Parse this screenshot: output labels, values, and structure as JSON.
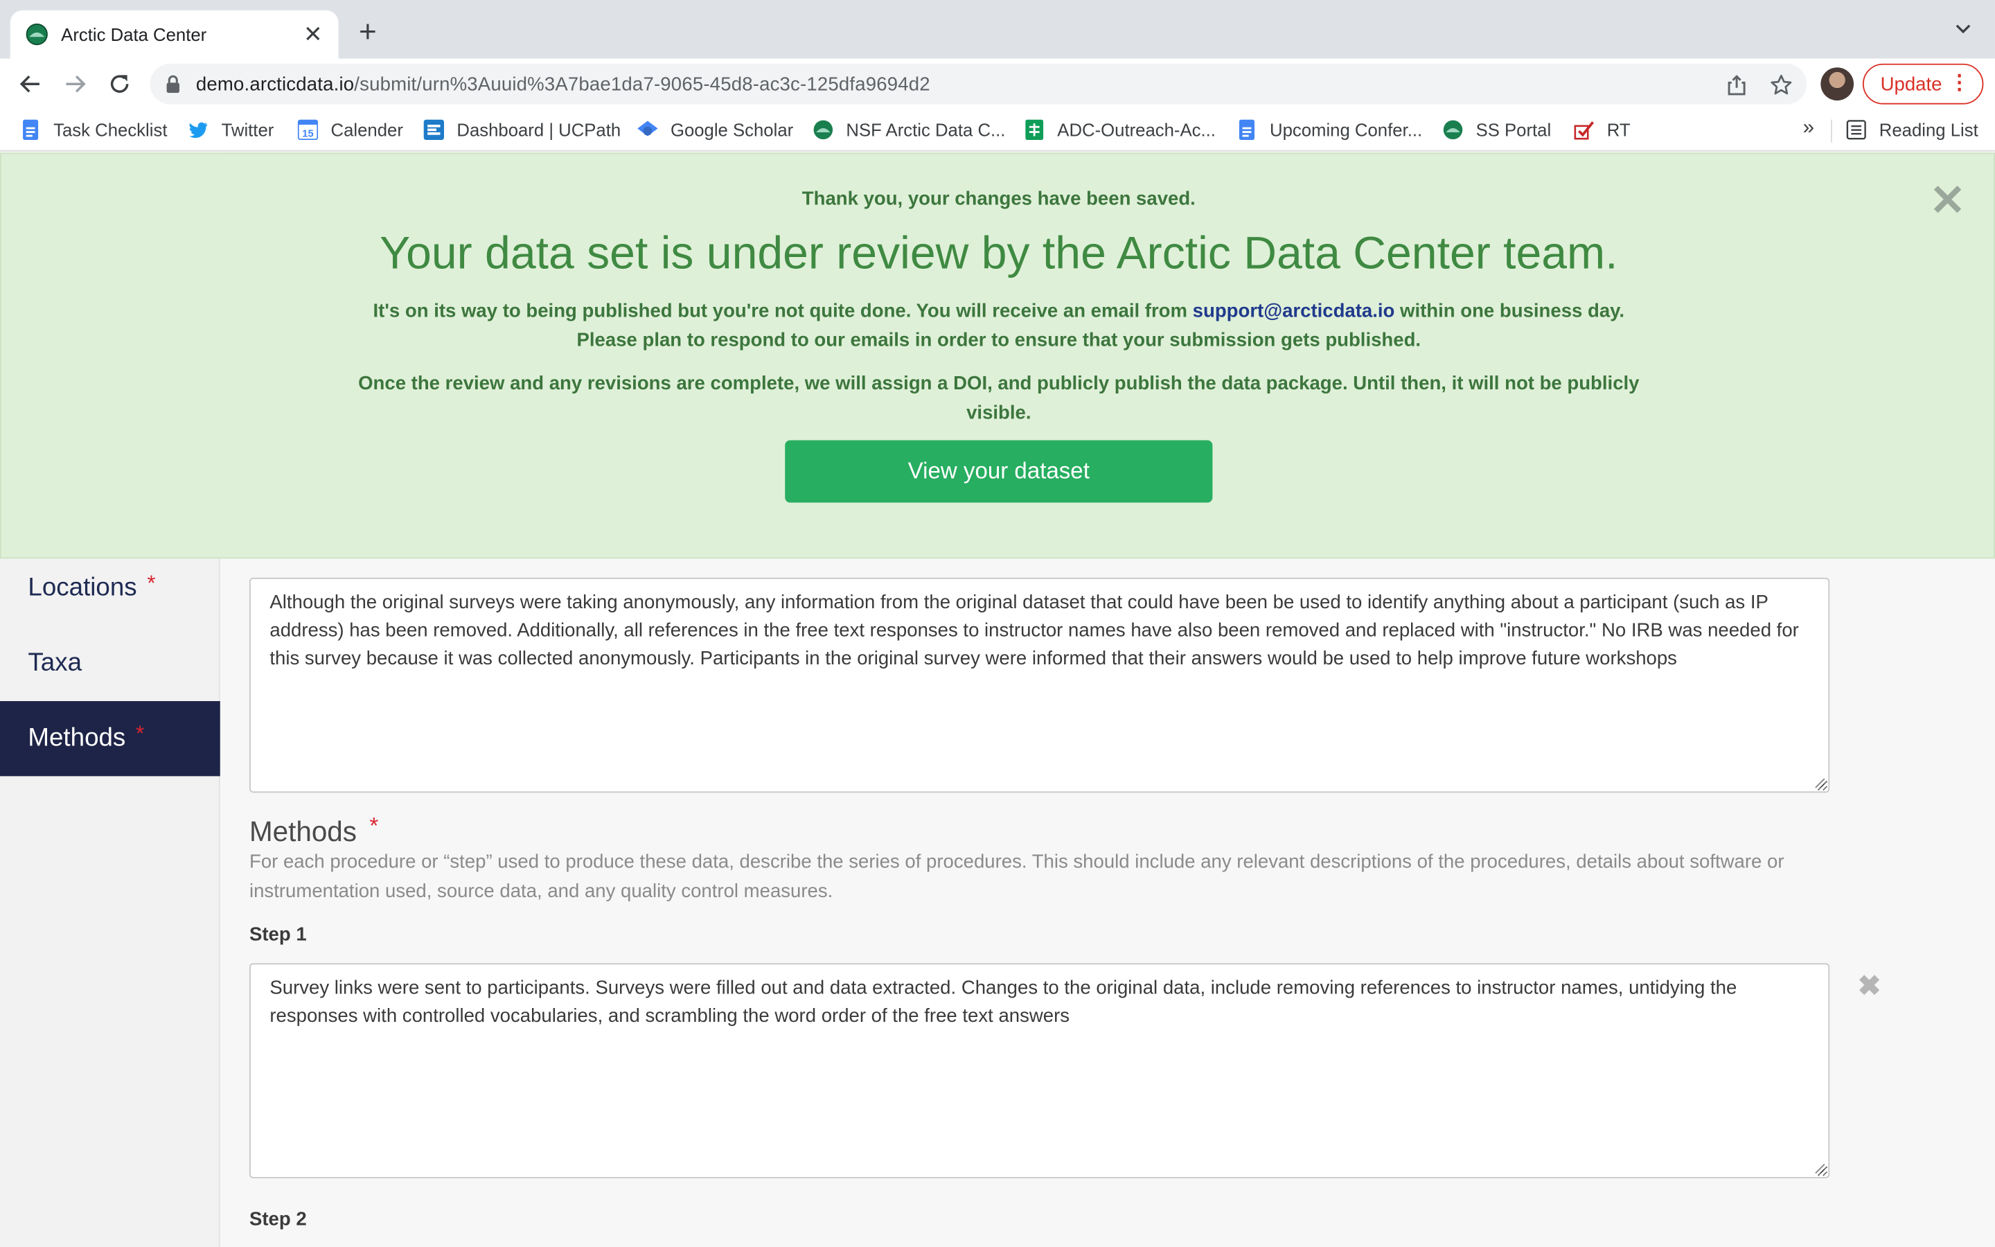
{
  "browser": {
    "tab_title": "Arctic Data Center",
    "url_host": "demo.arcticdata.io",
    "url_path": "/submit/urn%3Auuid%3A7bae1da7-9065-45d8-ac3c-125dfa9694d2",
    "update_label": "Update",
    "reading_list_label": "Reading List",
    "bookmarks": [
      {
        "label": "Task Checklist",
        "icon": "google-docs-icon"
      },
      {
        "label": "Twitter",
        "icon": "twitter-icon"
      },
      {
        "label": "Calender",
        "icon": "calendar-icon"
      },
      {
        "label": "Dashboard | UCPath",
        "icon": "ucpath-icon"
      },
      {
        "label": "Google Scholar",
        "icon": "scholar-icon"
      },
      {
        "label": "NSF Arctic Data C...",
        "icon": "arctic-data-icon"
      },
      {
        "label": "ADC-Outreach-Ac...",
        "icon": "google-sheets-icon"
      },
      {
        "label": "Upcoming Confer...",
        "icon": "google-docs-icon"
      },
      {
        "label": "SS Portal",
        "icon": "arctic-data-icon"
      },
      {
        "label": "RT",
        "icon": "rt-icon"
      }
    ]
  },
  "banner": {
    "saved_message": "Thank you, your changes have been saved.",
    "headline": "Your data set is under review by the Arctic Data Center team.",
    "line1_pre": "It's on its way to being published but you're not quite done. You will receive an email from ",
    "line1_email": "support@arcticdata.io",
    "line1_post": " within one business day.",
    "line2": "Please plan to respond to our emails in order to ensure that your submission gets published.",
    "line3": "Once the review and any revisions are complete, we will assign a DOI, and publicly publish the data package. Until then, it will not be publicly visible.",
    "view_button": "View your dataset"
  },
  "sidebar": {
    "items": [
      {
        "label": "Locations",
        "required": "*"
      },
      {
        "label": "Taxa",
        "required": ""
      },
      {
        "label": "Methods",
        "required": "*"
      }
    ]
  },
  "main": {
    "sharing_text": "Although the original surveys were taking anonymously, any information from the original dataset that could have been be used to identify anything about a participant (such as IP address) has been removed. Additionally, all references in the free text responses to instructor names have also been removed and replaced with \"instructor.\" No IRB was needed for this survey because it was collected anonymously. Participants in the original survey were informed that their answers would be used to help improve future workshops",
    "methods_title": "Methods",
    "methods_required": "*",
    "methods_description": "For each procedure or “step” used to produce these data, describe the series of procedures. This should include any relevant descriptions of the procedures, details about software or instrumentation used, source data, and any quality control measures.",
    "step1_label": "Step 1",
    "step1_text": "Survey links were sent to participants. Surveys were filled out and data extracted. Changes to the original data, include removing references to instructor names, untidying the responses with controlled vocabularies, and scrambling the word order of the free text answers",
    "step2_label": "Step 2"
  }
}
